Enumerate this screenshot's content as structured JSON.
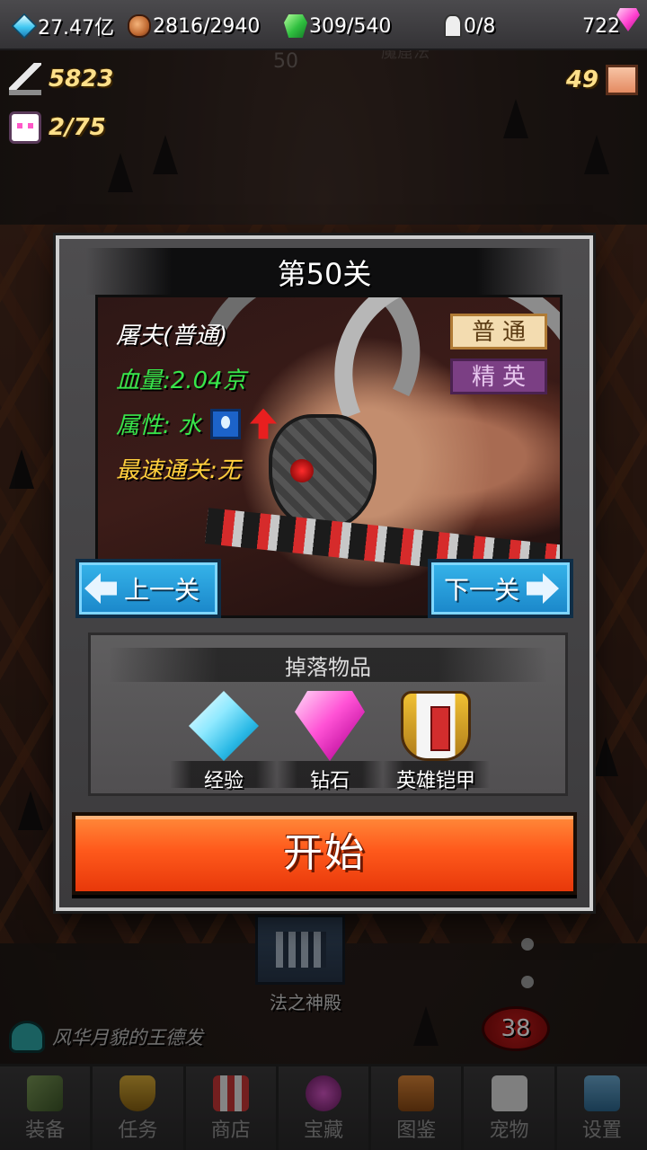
{
  "topbar": {
    "diamond_blue": "27.47亿",
    "food": "2816/2940",
    "gem_green": "309/540",
    "ghost": "0/8",
    "gem_pink": "722"
  },
  "hud": {
    "attack": "5823",
    "pets": "2/75",
    "boxes": "49"
  },
  "stage_bg": {
    "number": "50",
    "name": "魔窟法"
  },
  "modal": {
    "title": "第50关",
    "boss": {
      "name": "屠夫(普通)",
      "hp": "血量:2.04京",
      "attribute": "属性:  水",
      "record": "最速通关:无"
    },
    "difficulty": {
      "normal": "普通",
      "elite": "精英"
    },
    "prev_label": "上一关",
    "next_label": "下一关",
    "drops_title": "掉落物品",
    "drops": [
      {
        "label": "经验",
        "icon": "crystal-icon"
      },
      {
        "label": "钻石",
        "icon": "diamond-icon"
      },
      {
        "label": "英雄铠甲",
        "icon": "armor-icon"
      }
    ],
    "start_label": "开始"
  },
  "scene": {
    "temple_label": "法之神殿",
    "badge": "38",
    "chat_text": "风华月貌的王德发"
  },
  "bottom_nav": [
    {
      "label": "装备",
      "icon": "sword-icon"
    },
    {
      "label": "任务",
      "icon": "trophy-icon"
    },
    {
      "label": "商店",
      "icon": "shop-icon"
    },
    {
      "label": "宝藏",
      "icon": "treasure-icon"
    },
    {
      "label": "图鉴",
      "icon": "book-icon"
    },
    {
      "label": "宠物",
      "icon": "cat-icon"
    },
    {
      "label": "设置",
      "icon": "settings-icon"
    }
  ],
  "colors": {
    "hp_green": "#37e64a",
    "record_gold": "#ffcf3d",
    "start_orange": "#ff5a1c",
    "nav_blue": "#1a86c9",
    "elite_purple": "#7b3f84"
  }
}
